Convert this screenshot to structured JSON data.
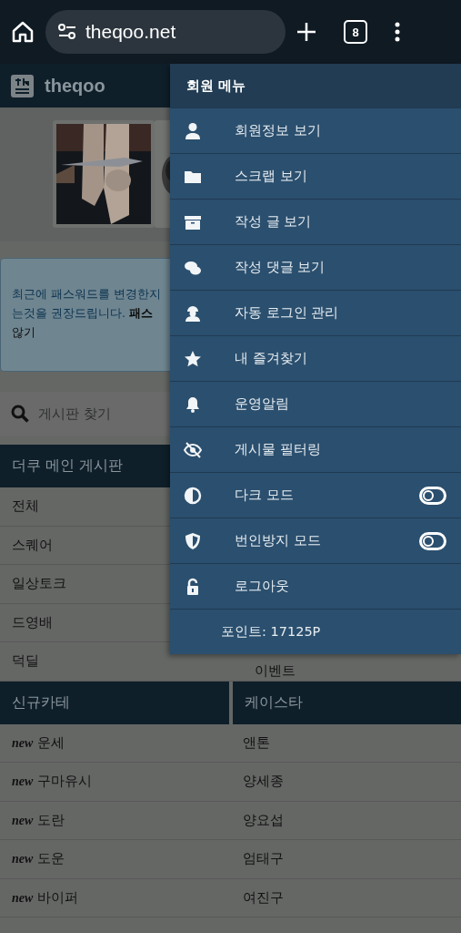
{
  "browser": {
    "url": "theqoo.net",
    "tab_count": "8"
  },
  "site": {
    "name": "theqoo"
  },
  "alert": {
    "lines": [
      "최근에 패스워드를 변경한지",
      "는것을 권장드립니다. **패스**",
      "않기"
    ]
  },
  "search": {
    "placeholder": "게시판 찾기"
  },
  "main_board": {
    "title": "더쿠 메인 게시판",
    "rows": [
      {
        "left": "전체"
      },
      {
        "left": "스퀘어"
      },
      {
        "left": "일상토크"
      },
      {
        "left": "드영배"
      },
      {
        "left": "덕딜",
        "right": "이벤트"
      }
    ]
  },
  "categories": {
    "columns": [
      "신규카테",
      "케이스타"
    ],
    "rows": [
      {
        "tag": "new",
        "left": "운세",
        "right": "앤톤"
      },
      {
        "tag": "new",
        "left": "구마유시",
        "right": "양세종"
      },
      {
        "tag": "new",
        "left": "도란",
        "right": "양요섭"
      },
      {
        "tag": "new",
        "left": "도운",
        "right": "엄태구"
      },
      {
        "tag": "new",
        "left": "바이퍼",
        "right": "여진구"
      }
    ]
  },
  "member_menu": {
    "title": "회원 메뉴",
    "items": [
      {
        "kind": "link",
        "label": "회원정보 보기"
      },
      {
        "kind": "link",
        "label": "스크랩 보기"
      },
      {
        "kind": "link",
        "label": "작성 글 보기"
      },
      {
        "kind": "link",
        "label": "작성 댓글 보기"
      },
      {
        "kind": "link",
        "label": "자동 로그인 관리"
      },
      {
        "kind": "link",
        "label": "내 즐겨찾기"
      },
      {
        "kind": "link",
        "label": "운영알림"
      },
      {
        "kind": "link",
        "label": "게시물 필터링"
      },
      {
        "kind": "toggle",
        "label": "다크 모드",
        "on": false
      },
      {
        "kind": "toggle",
        "label": "번인방지 모드",
        "on": false
      },
      {
        "kind": "link",
        "label": "로그아웃"
      },
      {
        "kind": "text",
        "label": "포인트: 17125P"
      }
    ]
  }
}
